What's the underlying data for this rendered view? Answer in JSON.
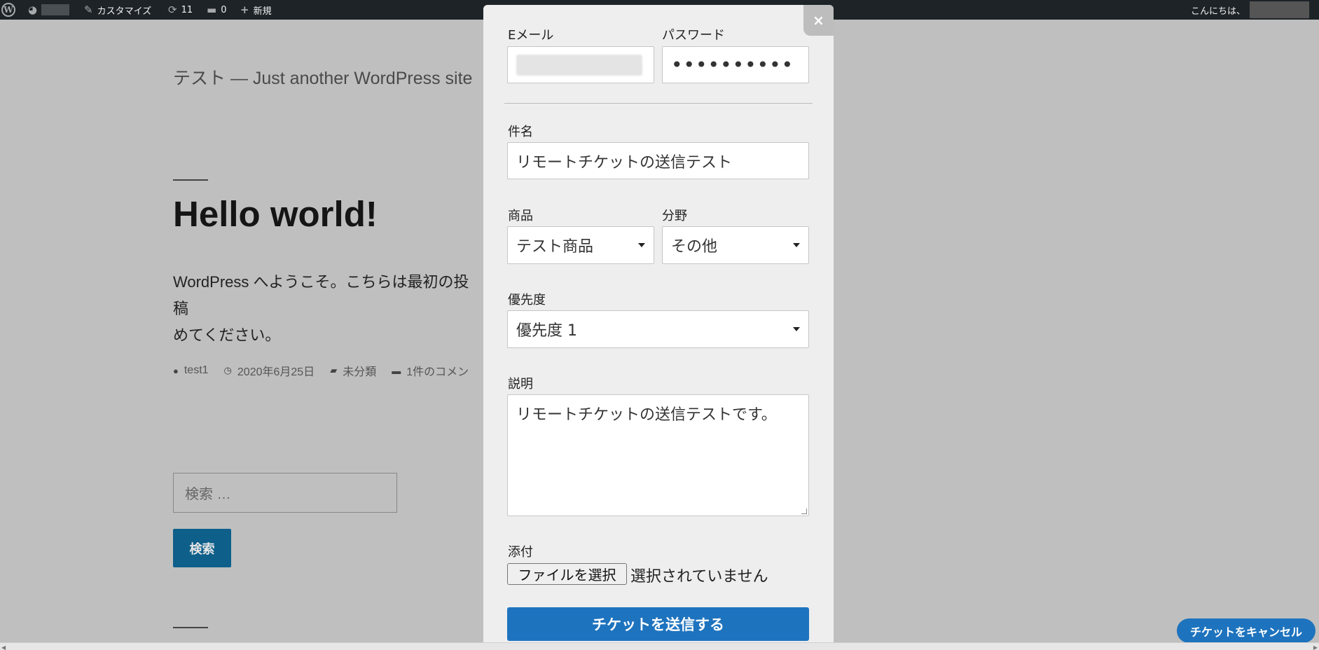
{
  "adminbar": {
    "wp_icon": "wordpress-logo-icon",
    "customize_label": "カスタマイズ",
    "updates_count": "11",
    "comments_count": "0",
    "new_label": "新規",
    "greeting": "こんにちは、"
  },
  "site": {
    "title": "テスト — Just another WordPress site",
    "post_title": "Hello world!",
    "post_body": "WordPress へようこそ。こちらは最初の投稿",
    "post_body_line2": "めてください。",
    "meta": {
      "author": "test1",
      "date": "2020年6月25日",
      "category": "未分類",
      "comments": "1件のコメン"
    },
    "search_placeholder": "検索 …",
    "search_button": "検索"
  },
  "modal": {
    "close_label": "×",
    "email_label": "Eメール",
    "password_label": "パスワード",
    "password_value": "••••••••••",
    "subject_label": "件名",
    "subject_value": "リモートチケットの送信テスト",
    "product_label": "商品",
    "product_value": "テスト商品",
    "field_label": "分野",
    "field_value": "その他",
    "priority_label": "優先度",
    "priority_value": "優先度 1",
    "description_label": "説明",
    "description_value": "リモートチケットの送信テストです。",
    "attach_label": "添付",
    "file_button": "ファイルを選択",
    "file_status": "選択されていません",
    "submit_label": "チケットを送信する"
  },
  "cancel_button": "チケットをキャンセル"
}
